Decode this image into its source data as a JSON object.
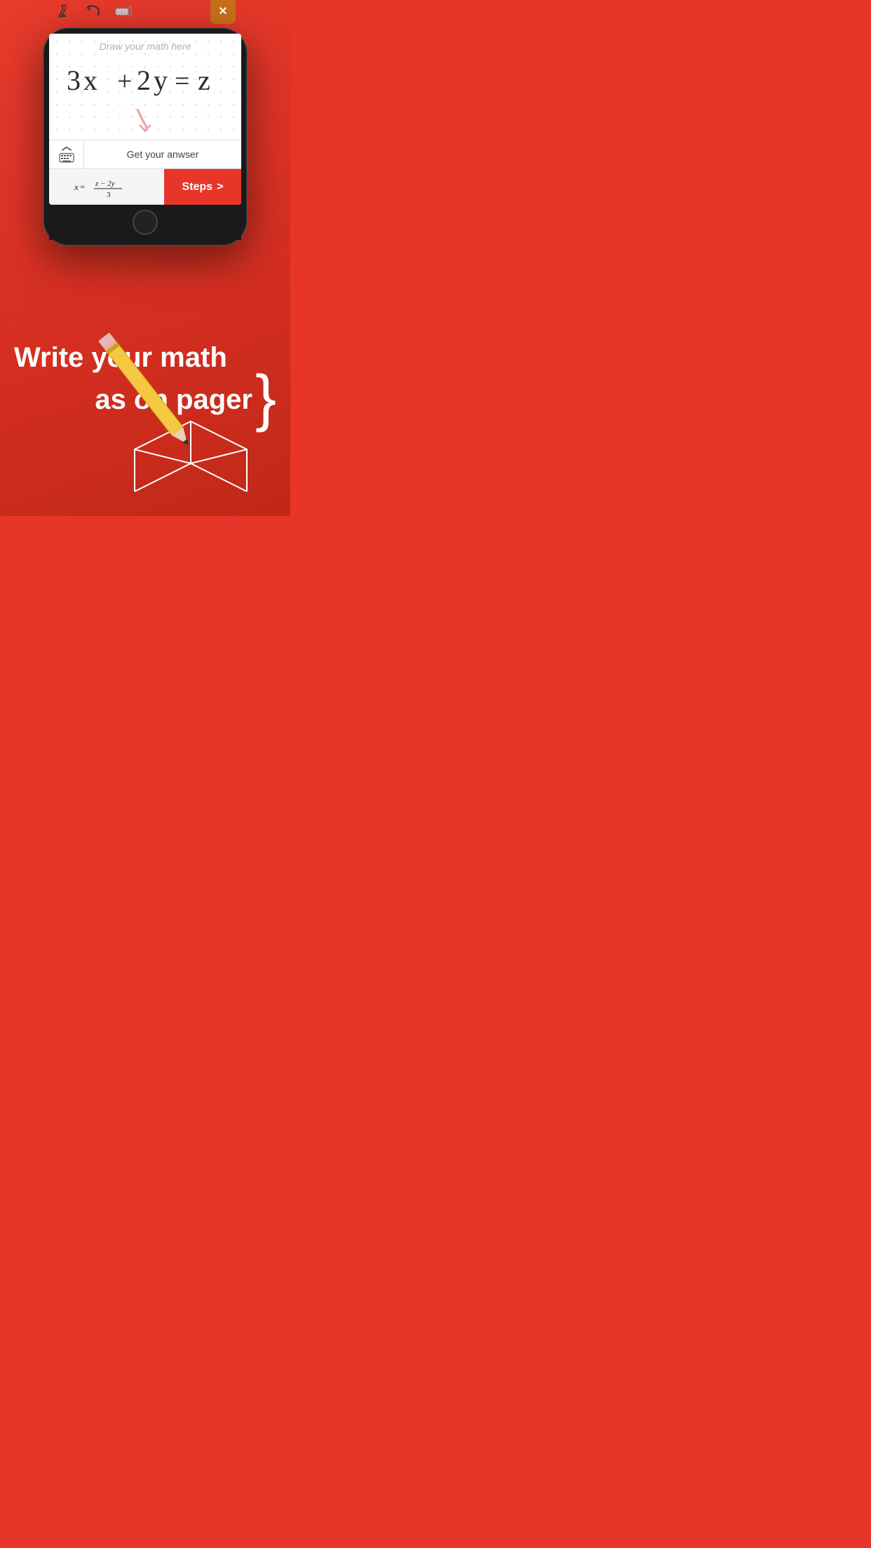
{
  "background": {
    "color": "#e8352a"
  },
  "toolbar": {
    "clear_icon": "🧹",
    "undo_icon": "↩",
    "eraser_icon": "⬜",
    "close_label": "✕"
  },
  "draw_area": {
    "placeholder": "Draw your math here",
    "expression": "3x + 2y = z"
  },
  "answer_bar": {
    "label": "Get your anwser"
  },
  "result": {
    "formula": "x = (z − 2y) / 3",
    "steps_label": "Steps",
    "steps_arrow": ">"
  },
  "tagline": {
    "line1": "Write your math",
    "line2": "as on pager",
    "brace": "}"
  }
}
